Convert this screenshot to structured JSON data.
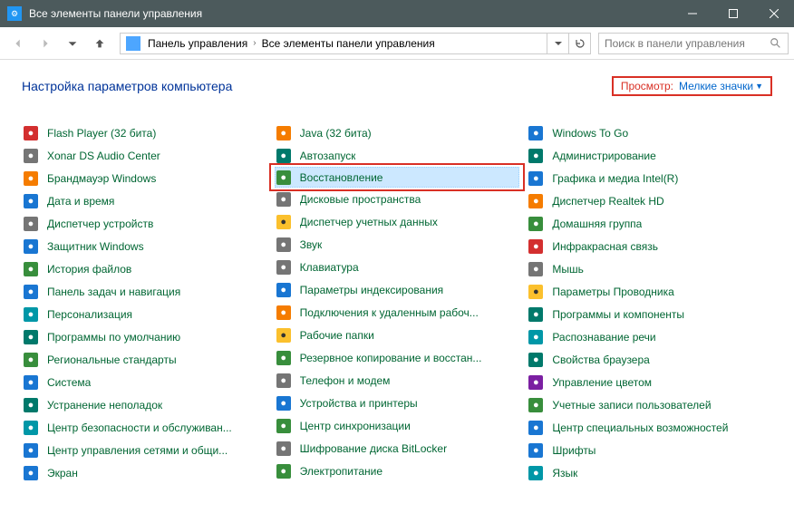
{
  "titlebar": {
    "title": "Все элементы панели управления"
  },
  "navbar": {
    "breadcrumbs": [
      "Панель управления",
      "Все элементы панели управления"
    ],
    "search_placeholder": "Поиск в панели управления"
  },
  "header": {
    "title": "Настройка параметров компьютера",
    "view_label": "Просмотр:",
    "view_value": "Мелкие значки"
  },
  "items": {
    "col1": [
      {
        "label": "Flash Player (32 бита)",
        "ic": "ic-red"
      },
      {
        "label": "Xonar DS Audio Center",
        "ic": "ic-gray"
      },
      {
        "label": "Брандмауэр Windows",
        "ic": "ic-orange"
      },
      {
        "label": "Дата и время",
        "ic": "ic-blue"
      },
      {
        "label": "Диспетчер устройств",
        "ic": "ic-gray"
      },
      {
        "label": "Защитник Windows",
        "ic": "ic-blue"
      },
      {
        "label": "История файлов",
        "ic": "ic-green"
      },
      {
        "label": "Панель задач и навигация",
        "ic": "ic-blue"
      },
      {
        "label": "Персонализация",
        "ic": "ic-cyan"
      },
      {
        "label": "Программы по умолчанию",
        "ic": "ic-teal"
      },
      {
        "label": "Региональные стандарты",
        "ic": "ic-green"
      },
      {
        "label": "Система",
        "ic": "ic-blue"
      },
      {
        "label": "Устранение неполадок",
        "ic": "ic-teal"
      },
      {
        "label": "Центр безопасности и обслуживан...",
        "ic": "ic-cyan"
      },
      {
        "label": "Центр управления сетями и общи...",
        "ic": "ic-blue"
      },
      {
        "label": "Экран",
        "ic": "ic-blue"
      }
    ],
    "col2": [
      {
        "label": "Java (32 бита)",
        "ic": "ic-orange"
      },
      {
        "label": "Автозапуск",
        "ic": "ic-teal"
      },
      {
        "label": "Восстановление",
        "ic": "ic-green",
        "highlighted": true
      },
      {
        "label": "Дисковые пространства",
        "ic": "ic-gray"
      },
      {
        "label": "Диспетчер учетных данных",
        "ic": "ic-yellow"
      },
      {
        "label": "Звук",
        "ic": "ic-gray"
      },
      {
        "label": "Клавиатура",
        "ic": "ic-gray"
      },
      {
        "label": "Параметры индексирования",
        "ic": "ic-blue"
      },
      {
        "label": "Подключения к удаленным рабоч...",
        "ic": "ic-orange"
      },
      {
        "label": "Рабочие папки",
        "ic": "ic-yellow"
      },
      {
        "label": "Резервное копирование и восстан...",
        "ic": "ic-green"
      },
      {
        "label": "Телефон и модем",
        "ic": "ic-gray"
      },
      {
        "label": "Устройства и принтеры",
        "ic": "ic-blue"
      },
      {
        "label": "Центр синхронизации",
        "ic": "ic-green"
      },
      {
        "label": "Шифрование диска BitLocker",
        "ic": "ic-gray"
      },
      {
        "label": "Электропитание",
        "ic": "ic-green"
      }
    ],
    "col3": [
      {
        "label": "Windows To Go",
        "ic": "ic-blue"
      },
      {
        "label": "Администрирование",
        "ic": "ic-teal"
      },
      {
        "label": "Графика и медиа Intel(R)",
        "ic": "ic-blue"
      },
      {
        "label": "Диспетчер Realtek HD",
        "ic": "ic-orange"
      },
      {
        "label": "Домашняя группа",
        "ic": "ic-green"
      },
      {
        "label": "Инфракрасная связь",
        "ic": "ic-red"
      },
      {
        "label": "Мышь",
        "ic": "ic-gray"
      },
      {
        "label": "Параметры Проводника",
        "ic": "ic-yellow"
      },
      {
        "label": "Программы и компоненты",
        "ic": "ic-teal"
      },
      {
        "label": "Распознавание речи",
        "ic": "ic-cyan"
      },
      {
        "label": "Свойства браузера",
        "ic": "ic-teal"
      },
      {
        "label": "Управление цветом",
        "ic": "ic-purple"
      },
      {
        "label": "Учетные записи пользователей",
        "ic": "ic-green"
      },
      {
        "label": "Центр специальных возможностей",
        "ic": "ic-blue"
      },
      {
        "label": "Шрифты",
        "ic": "ic-blue"
      },
      {
        "label": "Язык",
        "ic": "ic-cyan"
      }
    ]
  }
}
